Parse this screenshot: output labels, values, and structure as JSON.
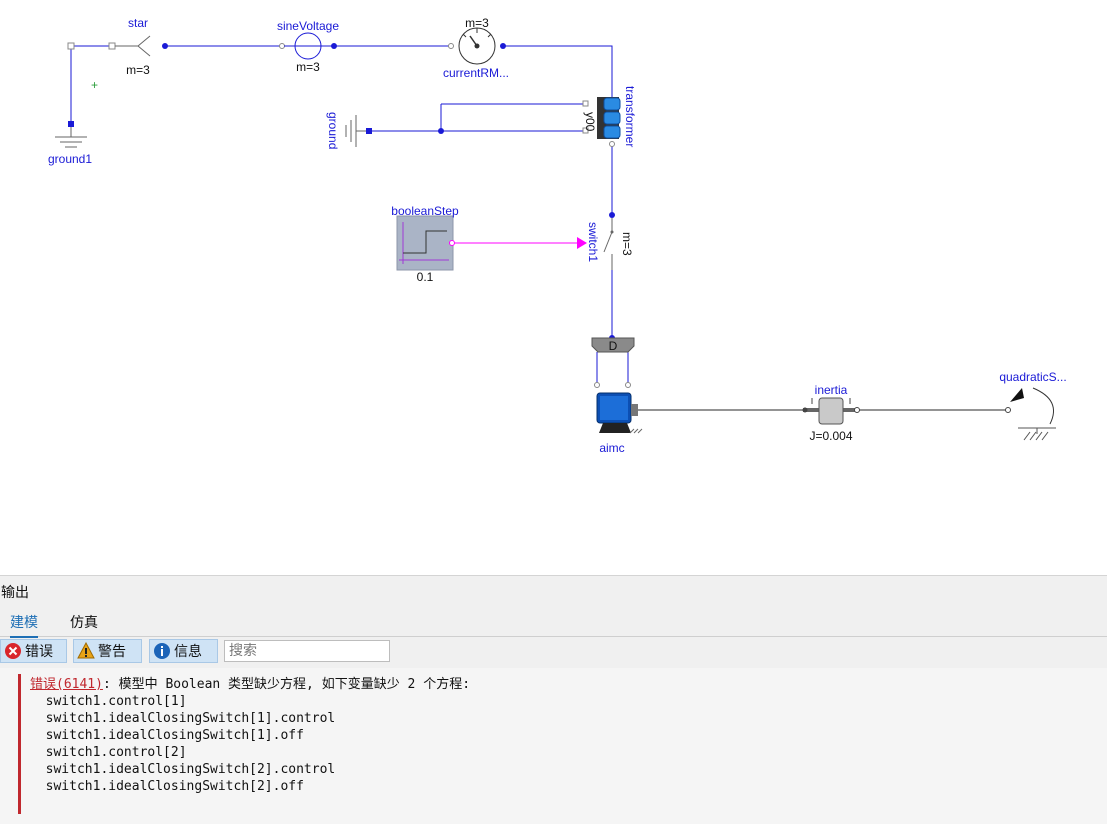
{
  "diagram": {
    "components": {
      "star": {
        "name": "star",
        "param": "m=3"
      },
      "ground1": {
        "name": "ground1"
      },
      "sineVoltage": {
        "name": "sineVoltage",
        "param": "m=3"
      },
      "currentRMS": {
        "name": "currentRM...",
        "param": "m=3"
      },
      "transformer": {
        "name": "transformer",
        "param": "y00"
      },
      "ground": {
        "name": "ground"
      },
      "booleanStep": {
        "name": "booleanStep",
        "param": "0.1"
      },
      "switch1": {
        "name": "switch1",
        "param": "m=3"
      },
      "terminalBox": {
        "name": "D"
      },
      "aimc": {
        "name": "aimc"
      },
      "inertia": {
        "name": "inertia",
        "param": "J=0.004"
      },
      "quadraticSpeed": {
        "name": "quadraticS..."
      }
    },
    "colors": {
      "electric": "#1a1ad6",
      "boolean": "#ff00ff",
      "mechanic": "#555555"
    }
  },
  "output": {
    "title": "输出",
    "tabs": [
      {
        "label": "建模",
        "active": true
      },
      {
        "label": "仿真",
        "active": false
      }
    ],
    "filters": {
      "errors": "错误",
      "warnings": "警告",
      "info": "信息"
    },
    "search_placeholder": "搜索",
    "message": {
      "error_link": "错误(6141)",
      "error_text": ": 模型中 Boolean 类型缺少方程, 如下变量缺少 2 个方程:",
      "lines": [
        "switch1.control[1]",
        "switch1.idealClosingSwitch[1].control",
        "switch1.idealClosingSwitch[1].off",
        "switch1.control[2]",
        "switch1.idealClosingSwitch[2].control",
        "switch1.idealClosingSwitch[2].off"
      ]
    }
  }
}
